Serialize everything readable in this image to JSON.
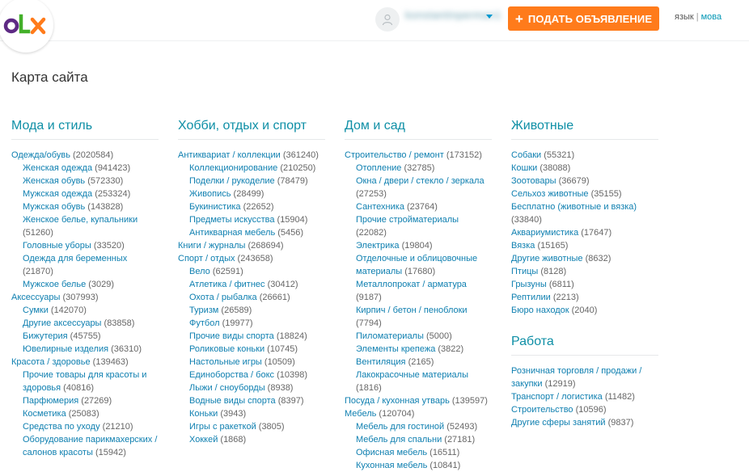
{
  "header": {
    "logo_text": "OLX",
    "user_name": "konstantinperman1",
    "post_button": "ПОДАТЬ ОБЪЯВЛЕНИЕ",
    "post_plus": "+",
    "lang_current": "язык",
    "lang_sep": "|",
    "lang_alt": "мова"
  },
  "colors": {
    "teal": "#0e8fa6",
    "link": "#0e7fb0",
    "orange": "#ff7b1b",
    "logo_o": "#5e2a84",
    "logo_l": "#43b02a",
    "logo_x": "#ff7b1b"
  },
  "page_title": "Карта сайта",
  "columns": [
    {
      "sections": [
        {
          "title": "Мода и стиль",
          "items": [
            {
              "t": "Одежда/обувь",
              "c": "(2020584)",
              "s": false
            },
            {
              "t": "Женская одежда",
              "c": "(941423)",
              "s": true
            },
            {
              "t": "Женская обувь",
              "c": "(572330)",
              "s": true
            },
            {
              "t": "Мужская одежда",
              "c": "(253324)",
              "s": true
            },
            {
              "t": "Мужская обувь",
              "c": "(143828)",
              "s": true
            },
            {
              "t": "Женское белье, купальники",
              "c": "(51260)",
              "s": true
            },
            {
              "t": "Головные уборы",
              "c": "(33520)",
              "s": true
            },
            {
              "t": "Одежда для беременных",
              "c": "(21870)",
              "s": true
            },
            {
              "t": "Мужское белье",
              "c": "(3029)",
              "s": true
            },
            {
              "t": "Аксессуары",
              "c": "(307993)",
              "s": false
            },
            {
              "t": "Сумки",
              "c": "(142070)",
              "s": true
            },
            {
              "t": "Другие аксессуары",
              "c": "(83858)",
              "s": true
            },
            {
              "t": "Бижутерия",
              "c": "(45755)",
              "s": true
            },
            {
              "t": "Ювелирные изделия",
              "c": "(36310)",
              "s": true
            },
            {
              "t": "Красота / здоровье",
              "c": "(139463)",
              "s": false
            },
            {
              "t": "Прочие товары для красоты и здоровья",
              "c": "(40816)",
              "s": true
            },
            {
              "t": "Парфюмерия",
              "c": "(27269)",
              "s": true
            },
            {
              "t": "Косметика",
              "c": "(25083)",
              "s": true
            },
            {
              "t": "Средства по уходу",
              "c": "(21210)",
              "s": true
            },
            {
              "t": "Оборудование парикмахерских / салонов красоты",
              "c": "(15942)",
              "s": true
            }
          ]
        }
      ]
    },
    {
      "sections": [
        {
          "title": "Хобби, отдых и спорт",
          "items": [
            {
              "t": "Антиквариат / коллекции",
              "c": "(361240)",
              "s": false
            },
            {
              "t": "Коллекционирование",
              "c": "(210250)",
              "s": true
            },
            {
              "t": "Поделки / рукоделие",
              "c": "(78479)",
              "s": true
            },
            {
              "t": "Живопись",
              "c": "(28499)",
              "s": true
            },
            {
              "t": "Букинистика",
              "c": "(22652)",
              "s": true
            },
            {
              "t": "Предметы искусства",
              "c": "(15904)",
              "s": true
            },
            {
              "t": "Антикварная мебель",
              "c": "(5456)",
              "s": true
            },
            {
              "t": "Книги / журналы",
              "c": "(268694)",
              "s": false
            },
            {
              "t": "Спорт / отдых",
              "c": "(243658)",
              "s": false
            },
            {
              "t": "Вело",
              "c": "(62591)",
              "s": true
            },
            {
              "t": "Атлетика / фитнес",
              "c": "(30412)",
              "s": true
            },
            {
              "t": "Охота / рыбалка",
              "c": "(26661)",
              "s": true
            },
            {
              "t": "Туризм",
              "c": "(26589)",
              "s": true
            },
            {
              "t": "Футбол",
              "c": "(19977)",
              "s": true
            },
            {
              "t": "Прочие виды спорта",
              "c": "(18824)",
              "s": true
            },
            {
              "t": "Роликовые коньки",
              "c": "(10745)",
              "s": true
            },
            {
              "t": "Настольные игры",
              "c": "(10509)",
              "s": true
            },
            {
              "t": "Единоборства / бокс",
              "c": "(10398)",
              "s": true
            },
            {
              "t": "Лыжи / сноуборды",
              "c": "(8938)",
              "s": true
            },
            {
              "t": "Водные виды спорта",
              "c": "(8397)",
              "s": true
            },
            {
              "t": "Коньки",
              "c": "(3943)",
              "s": true
            },
            {
              "t": "Игры с ракеткой",
              "c": "(3805)",
              "s": true
            },
            {
              "t": "Хоккей",
              "c": "(1868)",
              "s": true
            }
          ]
        }
      ]
    },
    {
      "sections": [
        {
          "title": "Дом и сад",
          "items": [
            {
              "t": "Строительство / ремонт",
              "c": "(173152)",
              "s": false
            },
            {
              "t": "Отопление",
              "c": "(32785)",
              "s": true
            },
            {
              "t": "Окна / двери / стекло / зеркала",
              "c": "(27253)",
              "s": true
            },
            {
              "t": "Сантехника",
              "c": "(23764)",
              "s": true
            },
            {
              "t": "Прочие стройматериалы",
              "c": "(22082)",
              "s": true
            },
            {
              "t": "Электрика",
              "c": "(19804)",
              "s": true
            },
            {
              "t": "Отделочные и облицовочные материалы",
              "c": "(17680)",
              "s": true
            },
            {
              "t": "Металлопрокат / арматура",
              "c": "(9187)",
              "s": true
            },
            {
              "t": "Кирпич / бетон / пеноблоки",
              "c": "(7794)",
              "s": true
            },
            {
              "t": "Пиломатериалы",
              "c": "(5000)",
              "s": true
            },
            {
              "t": "Элементы крепежа",
              "c": "(3822)",
              "s": true
            },
            {
              "t": "Вентиляция",
              "c": "(2165)",
              "s": true
            },
            {
              "t": "Лакокрасочные материалы",
              "c": "(1816)",
              "s": true
            },
            {
              "t": "Посуда / кухонная утварь",
              "c": "(139597)",
              "s": false
            },
            {
              "t": "Мебель",
              "c": "(120704)",
              "s": false
            },
            {
              "t": "Мебель для гостиной",
              "c": "(52493)",
              "s": true
            },
            {
              "t": "Мебель для спальни",
              "c": "(27181)",
              "s": true
            },
            {
              "t": "Офисная мебель",
              "c": "(16511)",
              "s": true
            },
            {
              "t": "Кухонная мебель",
              "c": "(10841)",
              "s": true
            }
          ]
        }
      ]
    },
    {
      "sections": [
        {
          "title": "Животные",
          "items": [
            {
              "t": "Собаки",
              "c": "(55321)",
              "s": false
            },
            {
              "t": "Кошки",
              "c": "(38088)",
              "s": false
            },
            {
              "t": "Зоотовары",
              "c": "(36679)",
              "s": false
            },
            {
              "t": "Сельхоз животные",
              "c": "(35155)",
              "s": false
            },
            {
              "t": "Бесплатно (животные и вязка)",
              "c": "(33840)",
              "s": false
            },
            {
              "t": "Аквариумистика",
              "c": "(17647)",
              "s": false
            },
            {
              "t": "Вязка",
              "c": "(15165)",
              "s": false
            },
            {
              "t": "Другие животные",
              "c": "(8632)",
              "s": false
            },
            {
              "t": "Птицы",
              "c": "(8128)",
              "s": false
            },
            {
              "t": "Грызуны",
              "c": "(6811)",
              "s": false
            },
            {
              "t": "Рептилии",
              "c": "(2213)",
              "s": false
            },
            {
              "t": "Бюро находок",
              "c": "(2040)",
              "s": false
            }
          ]
        },
        {
          "title": "Работа",
          "items": [
            {
              "t": "Розничная торговля / продажи / закупки",
              "c": "(12919)",
              "s": false
            },
            {
              "t": "Транспорт / логистика",
              "c": "(11482)",
              "s": false
            },
            {
              "t": "Строительство",
              "c": "(10596)",
              "s": false
            },
            {
              "t": "Другие сферы занятий",
              "c": "(9837)",
              "s": false
            }
          ]
        }
      ]
    }
  ]
}
